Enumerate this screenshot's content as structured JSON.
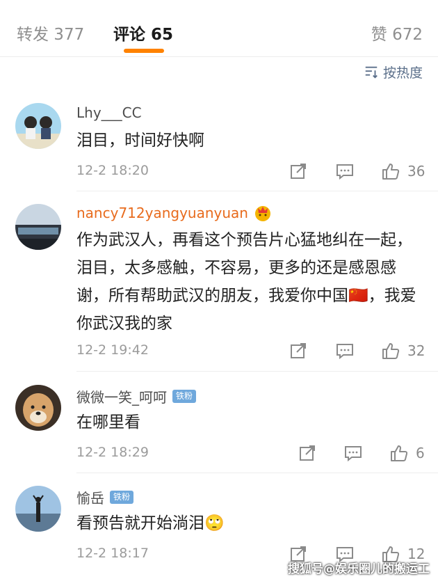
{
  "tabs": {
    "repost": "转发 377",
    "comments": "评论 65",
    "likes": "赞 672"
  },
  "sort": {
    "label": "按热度",
    "icon": "sort-icon"
  },
  "comments": [
    {
      "name": "Lhy___CC",
      "text": "泪目，时间好快啊",
      "time": "12-2 18:20",
      "likes": "36"
    },
    {
      "name": "nancy712yangyuanyuan",
      "text": "作为武汉人，再看这个预告片心猛地纠在一起，泪目，太多感触，不容易，更多的还是感恩感谢，所有帮助武汉的朋友，我爱你中国🇨🇳，我爱你武汉我的家",
      "time": "12-2 19:42",
      "likes": "32"
    },
    {
      "name": "微微一笑_呵呵",
      "badge": "铁粉",
      "text": "在哪里看",
      "time": "12-2 18:29",
      "likes": "6"
    },
    {
      "name": "愉岳",
      "badge": "铁粉",
      "text": "看预告就开始淌泪🙄",
      "time": "12-2 18:17",
      "likes": "12"
    }
  ],
  "watermark": "搜狐号@娱乐圈儿的搬运工",
  "colors": {
    "accent": "#ff8200",
    "link": "#5b6f8a",
    "badge": "#6fa8dc",
    "vip_name": "#e86b1d"
  }
}
